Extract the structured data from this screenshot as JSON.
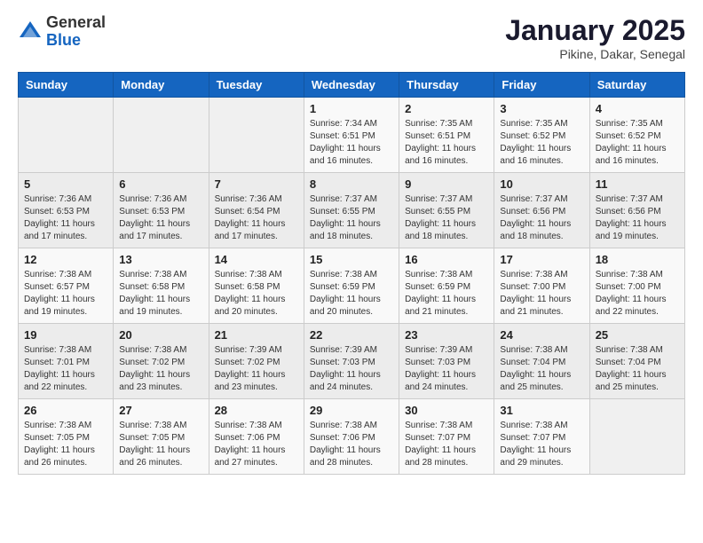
{
  "header": {
    "logo_general": "General",
    "logo_blue": "Blue",
    "month_title": "January 2025",
    "subtitle": "Pikine, Dakar, Senegal"
  },
  "days_of_week": [
    "Sunday",
    "Monday",
    "Tuesday",
    "Wednesday",
    "Thursday",
    "Friday",
    "Saturday"
  ],
  "weeks": [
    [
      {
        "day": "",
        "info": ""
      },
      {
        "day": "",
        "info": ""
      },
      {
        "day": "",
        "info": ""
      },
      {
        "day": "1",
        "info": "Sunrise: 7:34 AM\nSunset: 6:51 PM\nDaylight: 11 hours and 16 minutes."
      },
      {
        "day": "2",
        "info": "Sunrise: 7:35 AM\nSunset: 6:51 PM\nDaylight: 11 hours and 16 minutes."
      },
      {
        "day": "3",
        "info": "Sunrise: 7:35 AM\nSunset: 6:52 PM\nDaylight: 11 hours and 16 minutes."
      },
      {
        "day": "4",
        "info": "Sunrise: 7:35 AM\nSunset: 6:52 PM\nDaylight: 11 hours and 16 minutes."
      }
    ],
    [
      {
        "day": "5",
        "info": "Sunrise: 7:36 AM\nSunset: 6:53 PM\nDaylight: 11 hours and 17 minutes."
      },
      {
        "day": "6",
        "info": "Sunrise: 7:36 AM\nSunset: 6:53 PM\nDaylight: 11 hours and 17 minutes."
      },
      {
        "day": "7",
        "info": "Sunrise: 7:36 AM\nSunset: 6:54 PM\nDaylight: 11 hours and 17 minutes."
      },
      {
        "day": "8",
        "info": "Sunrise: 7:37 AM\nSunset: 6:55 PM\nDaylight: 11 hours and 18 minutes."
      },
      {
        "day": "9",
        "info": "Sunrise: 7:37 AM\nSunset: 6:55 PM\nDaylight: 11 hours and 18 minutes."
      },
      {
        "day": "10",
        "info": "Sunrise: 7:37 AM\nSunset: 6:56 PM\nDaylight: 11 hours and 18 minutes."
      },
      {
        "day": "11",
        "info": "Sunrise: 7:37 AM\nSunset: 6:56 PM\nDaylight: 11 hours and 19 minutes."
      }
    ],
    [
      {
        "day": "12",
        "info": "Sunrise: 7:38 AM\nSunset: 6:57 PM\nDaylight: 11 hours and 19 minutes."
      },
      {
        "day": "13",
        "info": "Sunrise: 7:38 AM\nSunset: 6:58 PM\nDaylight: 11 hours and 19 minutes."
      },
      {
        "day": "14",
        "info": "Sunrise: 7:38 AM\nSunset: 6:58 PM\nDaylight: 11 hours and 20 minutes."
      },
      {
        "day": "15",
        "info": "Sunrise: 7:38 AM\nSunset: 6:59 PM\nDaylight: 11 hours and 20 minutes."
      },
      {
        "day": "16",
        "info": "Sunrise: 7:38 AM\nSunset: 6:59 PM\nDaylight: 11 hours and 21 minutes."
      },
      {
        "day": "17",
        "info": "Sunrise: 7:38 AM\nSunset: 7:00 PM\nDaylight: 11 hours and 21 minutes."
      },
      {
        "day": "18",
        "info": "Sunrise: 7:38 AM\nSunset: 7:00 PM\nDaylight: 11 hours and 22 minutes."
      }
    ],
    [
      {
        "day": "19",
        "info": "Sunrise: 7:38 AM\nSunset: 7:01 PM\nDaylight: 11 hours and 22 minutes."
      },
      {
        "day": "20",
        "info": "Sunrise: 7:38 AM\nSunset: 7:02 PM\nDaylight: 11 hours and 23 minutes."
      },
      {
        "day": "21",
        "info": "Sunrise: 7:39 AM\nSunset: 7:02 PM\nDaylight: 11 hours and 23 minutes."
      },
      {
        "day": "22",
        "info": "Sunrise: 7:39 AM\nSunset: 7:03 PM\nDaylight: 11 hours and 24 minutes."
      },
      {
        "day": "23",
        "info": "Sunrise: 7:39 AM\nSunset: 7:03 PM\nDaylight: 11 hours and 24 minutes."
      },
      {
        "day": "24",
        "info": "Sunrise: 7:38 AM\nSunset: 7:04 PM\nDaylight: 11 hours and 25 minutes."
      },
      {
        "day": "25",
        "info": "Sunrise: 7:38 AM\nSunset: 7:04 PM\nDaylight: 11 hours and 25 minutes."
      }
    ],
    [
      {
        "day": "26",
        "info": "Sunrise: 7:38 AM\nSunset: 7:05 PM\nDaylight: 11 hours and 26 minutes."
      },
      {
        "day": "27",
        "info": "Sunrise: 7:38 AM\nSunset: 7:05 PM\nDaylight: 11 hours and 26 minutes."
      },
      {
        "day": "28",
        "info": "Sunrise: 7:38 AM\nSunset: 7:06 PM\nDaylight: 11 hours and 27 minutes."
      },
      {
        "day": "29",
        "info": "Sunrise: 7:38 AM\nSunset: 7:06 PM\nDaylight: 11 hours and 28 minutes."
      },
      {
        "day": "30",
        "info": "Sunrise: 7:38 AM\nSunset: 7:07 PM\nDaylight: 11 hours and 28 minutes."
      },
      {
        "day": "31",
        "info": "Sunrise: 7:38 AM\nSunset: 7:07 PM\nDaylight: 11 hours and 29 minutes."
      },
      {
        "day": "",
        "info": ""
      }
    ]
  ]
}
